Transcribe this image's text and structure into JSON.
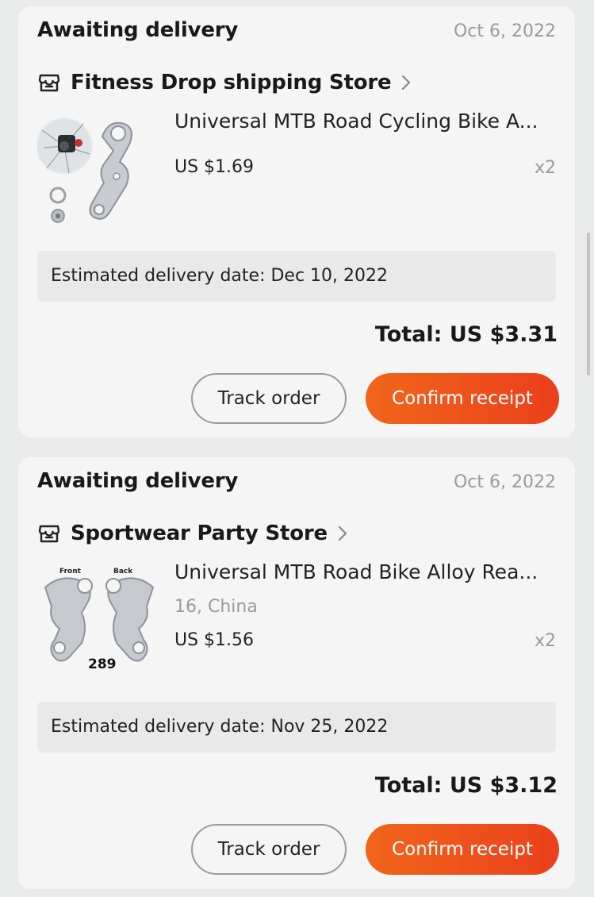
{
  "orders": [
    {
      "status": "Awaiting delivery",
      "date": "Oct 6, 2022",
      "store_name": "Fitness Drop shipping Store",
      "product_name": "Universal MTB Road Cycling  Bike A...",
      "variant": "",
      "price": "US $1.69",
      "quantity": "x2",
      "estimated_delivery": "Estimated delivery date: Dec 10, 2022",
      "total": "Total: US $3.31",
      "track_label": "Track order",
      "confirm_label": "Confirm receipt"
    },
    {
      "status": "Awaiting delivery",
      "date": "Oct 6, 2022",
      "store_name": "Sportwear Party Store",
      "product_name": "Universal MTB Road  Bike Alloy Rea...",
      "variant": "16, China",
      "price": "US $1.56",
      "quantity": "x2",
      "estimated_delivery": "Estimated delivery date: Nov 25, 2022",
      "total": "Total: US $3.12",
      "track_label": "Track order",
      "confirm_label": "Confirm receipt",
      "image_labels": {
        "front": "Front",
        "back": "Back",
        "model": "289"
      }
    }
  ],
  "icons": {
    "store": "store-icon",
    "chevron": "chevron-right-icon"
  },
  "colors": {
    "accent_start": "#f1661b",
    "accent_end": "#ec3f1c",
    "card_bg": "#f4f5f4",
    "page_bg": "#e9ebea"
  }
}
